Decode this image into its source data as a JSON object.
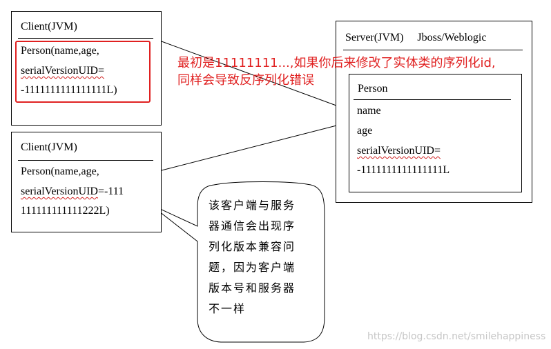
{
  "client1": {
    "title": "Client(JVM)",
    "line1": "Person(name,age,",
    "line2": "serialVersionUID=",
    "line3": "-1111111111111111L)"
  },
  "client2": {
    "title": "Client(JVM)",
    "line1": "Person(name,age,",
    "line2a": "serialVersionUID",
    "line2b": "=-111",
    "line3": "111111111111222L)"
  },
  "server": {
    "title_a": "Server(JVM)",
    "title_b": "Jboss/Weblogic",
    "inner_title": "Person",
    "field_name": "name",
    "field_age": "age",
    "field_uid": "serialVersionUID=",
    "field_uid_value": "-1111111111111111L"
  },
  "note": {
    "line1": "最初是11111111...,如果你后来修改了实体类的序列化id,",
    "line2": "同样会导致反序列化错误"
  },
  "bubble": {
    "lines": [
      "该客户端与服务",
      "器通信会出现序",
      "列化版本兼容问",
      "题，因为客户端",
      "版本号和服务器",
      "不一样"
    ]
  },
  "watermark": "https://blog.csdn.net/smilehappiness",
  "colors": {
    "highlight": "#e02020",
    "border": "#000000",
    "watermark": "#c6c6c6"
  }
}
